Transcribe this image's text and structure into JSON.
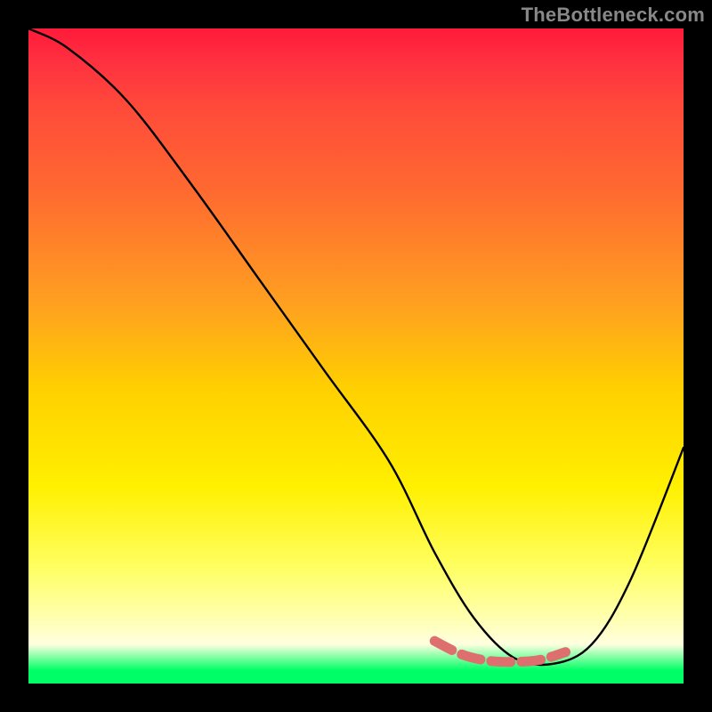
{
  "watermark": "TheBottleneck.com",
  "chart_data": {
    "type": "line",
    "title": "",
    "xlabel": "",
    "ylabel": "",
    "xlim": [
      0,
      100
    ],
    "ylim": [
      0,
      100
    ],
    "grid": false,
    "legend": false,
    "series": [
      {
        "name": "bottleneck-curve",
        "color": "#000000",
        "x": [
          0,
          6,
          15,
          25,
          35,
          45,
          55,
          62,
          68,
          74,
          80,
          86,
          92,
          100
        ],
        "values": [
          100,
          97,
          89,
          76,
          62,
          48,
          34,
          20,
          10,
          4,
          3,
          6,
          16,
          36
        ]
      }
    ],
    "annotations": [
      {
        "name": "optimal-zone-marker",
        "color": "#e07070",
        "x": [
          62,
          66,
          70,
          74,
          78,
          82
        ],
        "values": [
          6.5,
          4.5,
          3.5,
          3.3,
          3.6,
          4.8
        ]
      }
    ],
    "background_gradient": {
      "top": "#ff1a3a",
      "middle": "#ffe000",
      "bottom": "#00ff66"
    }
  }
}
